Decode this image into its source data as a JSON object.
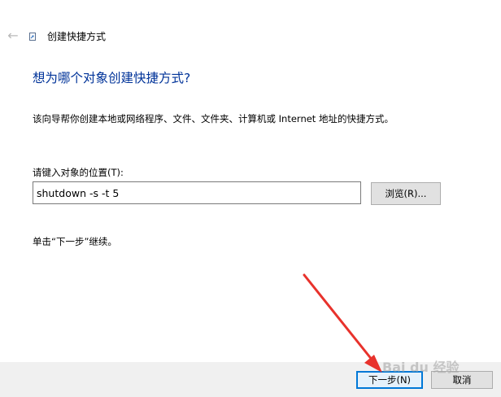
{
  "titlebar": {
    "title": "创建快捷方式",
    "back_icon": "back-arrow-icon",
    "wizard_icon": "shortcut-icon"
  },
  "main": {
    "heading": "想为哪个对象创建快捷方式?",
    "description": "该向导帮你创建本地或网络程序、文件、文件夹、计算机或 Internet 地址的快捷方式。",
    "location_label": "请键入对象的位置(T):",
    "location_value": "shutdown -s -t 5",
    "browse_label": "浏览(R)...",
    "hint": "单击“下一步”继续。"
  },
  "footer": {
    "next_label": "下一步(N)",
    "cancel_label": "取消"
  },
  "annotation": {
    "arrow_color": "#e8322c",
    "watermark": "Bai du 经验"
  },
  "colors": {
    "heading": "#003399",
    "footer_bg": "#f0f0f0",
    "primary_border": "#0078d7"
  }
}
